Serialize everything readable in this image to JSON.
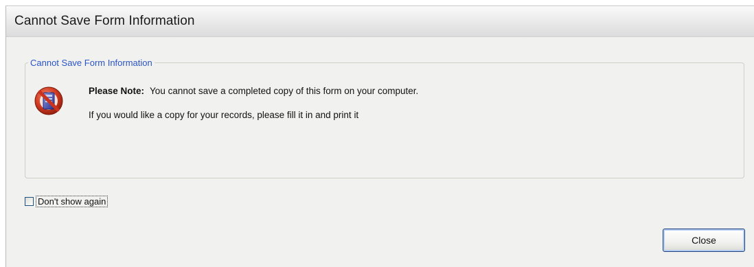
{
  "window": {
    "title": "Cannot Save Form Information"
  },
  "group": {
    "legend": "Cannot Save Form Information",
    "icon": "error-stop-icon",
    "note_label": "Please Note:",
    "note_text": "You cannot save a completed copy of this form on your computer.",
    "copy_text": "If you would like a copy for your records, please fill it in and print it"
  },
  "options": {
    "dont_show_label": "Don't show again",
    "dont_show_checked": false
  },
  "buttons": {
    "close_label": "Close"
  },
  "colors": {
    "legend_text": "#2a54c8",
    "icon_red": "#c8321e",
    "icon_blue": "#3a3fa0",
    "button_border": "#1a3f7a"
  }
}
